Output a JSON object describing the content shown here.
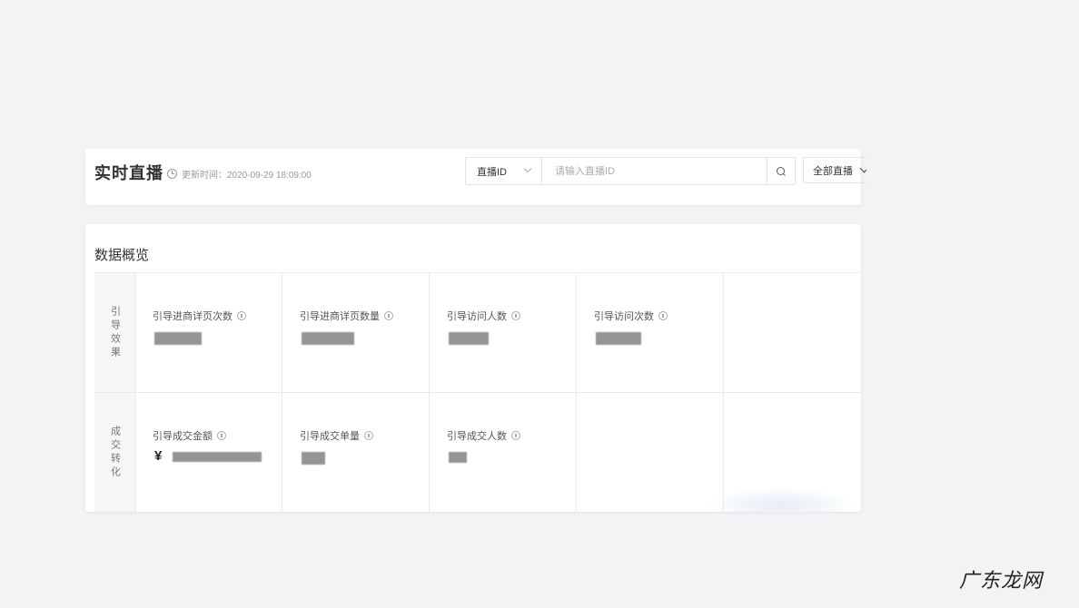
{
  "header": {
    "title": "实时直播",
    "update_time": "更新时间：2020-09-29 18:09:00",
    "search_type": "直播ID",
    "search_placeholder": "请输入直播ID",
    "filter_select": "全部直播"
  },
  "overview": {
    "title": "数据概览",
    "rows": [
      {
        "label": "引导效果",
        "metrics": [
          {
            "label": "引导进商详页次数",
            "value": "●●●●●●"
          },
          {
            "label": "引导进商详页数量",
            "value": "●●●●●●●"
          },
          {
            "label": "引导访问人数",
            "value": "●●●●●"
          },
          {
            "label": "引导访问次数",
            "value": "●●●●●●"
          }
        ]
      },
      {
        "label": "成交转化",
        "metrics": [
          {
            "label": "引导成交金额",
            "currency": "¥",
            "value": "●●●●●●●●●●●●"
          },
          {
            "label": "引导成交单量",
            "value": "●●●"
          },
          {
            "label": "引导成交人数",
            "value": "●●"
          }
        ]
      }
    ]
  },
  "watermark": "广东龙网",
  "icons": {
    "clock": "clock-icon",
    "search": "search-icon",
    "info": "info-icon",
    "chevron": "chevron-down-icon"
  }
}
